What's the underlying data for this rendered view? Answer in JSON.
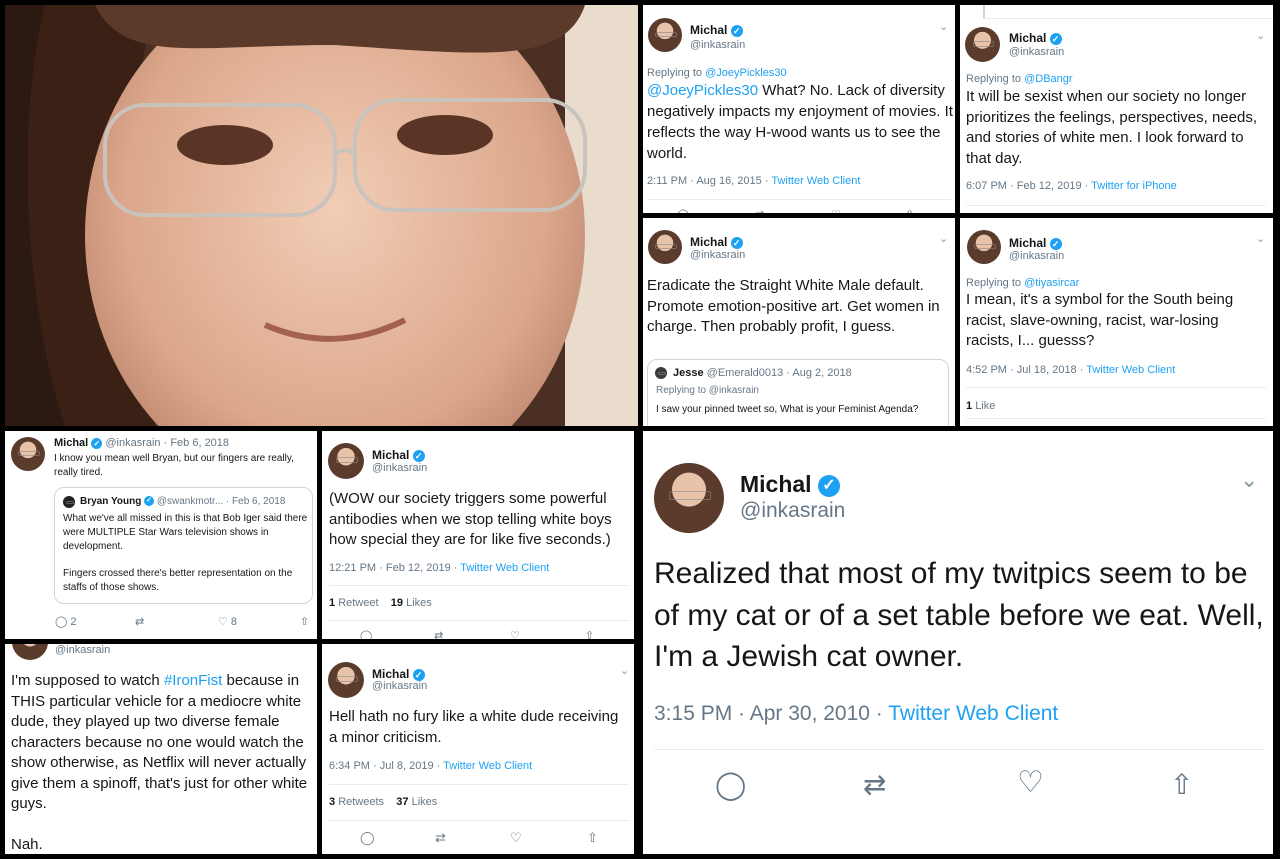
{
  "photo": {
    "description_icon": "selfie-photo"
  },
  "t1": {
    "name": "Michal",
    "handle": "@inkasrain",
    "replying_prefix": "Replying to",
    "replying_handle": "@JoeyPickles30",
    "mention": "@JoeyPickles30",
    "text": " What? No. Lack of diversity negatively impacts my enjoyment of movies. It reflects the way H-wood wants us to see the world.",
    "time": "2:11 PM · Aug 16, 2015 · ",
    "source": "Twitter Web Client"
  },
  "t2": {
    "name": "Michal",
    "handle": "@inkasrain",
    "replying_prefix": "Replying to",
    "replying_handle": "@DBangr",
    "text": "It will be sexist when our society no longer prioritizes the feelings, perspectives, needs, and stories of white men. I look forward to that day.",
    "time": "6:07 PM · Feb 12, 2019 · ",
    "source": "Twitter for iPhone"
  },
  "t3": {
    "name": "Michal",
    "handle": "@inkasrain",
    "text": "Eradicate the Straight White Male default. Promote emotion-positive art. Get women in charge. Then probably profit, I guess.",
    "quote_name": "Jesse",
    "quote_handle": "@Emerald0013 · Aug 2, 2018",
    "quote_reply": "Replying to @inkasrain",
    "quote_text": "I saw your pinned tweet so, What is your Feminist Agenda?"
  },
  "t4": {
    "name": "Michal",
    "handle": "@inkasrain",
    "replying_prefix": "Replying to",
    "replying_handle": "@tiyasircar",
    "text": "I mean, it's a symbol for the South being racist, slave-owning, racist, war-losing racists, I... guesss?",
    "time": "4:52 PM · Jul 18, 2018 · ",
    "source": "Twitter Web Client",
    "likes_count": "1",
    "likes_label": "Like"
  },
  "t5": {
    "name": "Michal",
    "handle": "@inkasrain · Feb 6, 2018",
    "text": "I know you mean well Bryan, but our fingers are really, really tired.",
    "quote_name": "Bryan Young",
    "quote_handle": "@swankmotr... · Feb 6, 2018",
    "quote_text_1": "What we've all missed in this is that Bob Iger said there were MULTIPLE Star Wars television shows in development.",
    "quote_text_2": "Fingers crossed there's better representation on the staffs of those shows.",
    "replies": "2",
    "likes": "8"
  },
  "t6": {
    "name": "Michal",
    "handle": "@inkasrain",
    "text": "(WOW our society triggers some powerful antibodies when we stop telling white boys how special they are for like five seconds.)",
    "time": "12:21 PM · Feb 12, 2019 · ",
    "source": "Twitter Web Client",
    "retweets_count": "1",
    "retweets_label": "Retweet",
    "likes_count": "19",
    "likes_label": "Likes"
  },
  "t7": {
    "handle": "@inkasrain",
    "text_1": "I'm supposed to watch ",
    "hashtag": "#IronFist",
    "text_2": " because in THIS particular vehicle for a mediocre white dude, they played up two diverse female characters because no one would watch the show otherwise, as Netflix will never actually give them a spinoff, that's just for other white guys.",
    "text_3": "Nah."
  },
  "t8": {
    "name": "Michal",
    "handle": "@inkasrain",
    "text": "Hell hath no fury like a white dude receiving a minor criticism.",
    "time": "6:34 PM · Jul 8, 2019 · ",
    "source": "Twitter Web Client",
    "retweets_count": "3",
    "retweets_label": "Retweets",
    "likes_count": "37",
    "likes_label": "Likes"
  },
  "t9": {
    "name": "Michal",
    "handle": "@inkasrain",
    "text": "Realized that most of my twitpics seem to be of my cat or of a set table before we eat. Well, I'm a Jewish cat owner.",
    "time": "3:15 PM · Apr 30, 2010 · ",
    "source": "Twitter Web Client"
  },
  "colors": {
    "accent": "#1da1f2",
    "text": "#14171a",
    "muted": "#657786"
  }
}
